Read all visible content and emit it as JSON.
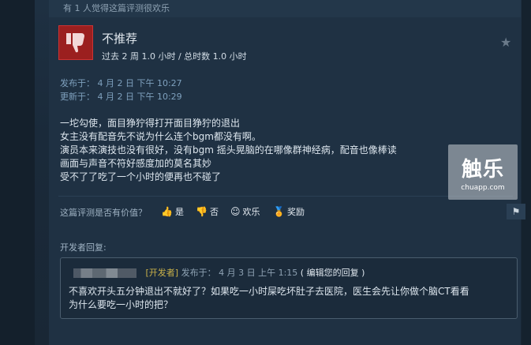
{
  "review": {
    "helpful_count_text": "有 1 人觉得这篇评测很欢乐",
    "verdict": "不推荐",
    "hours_text": "过去 2 周 1.0 小时 / 总时数 1.0 小时",
    "posted_line": "发布于：  4 月 2 日 下午 10:27",
    "updated_line": "更新于：  4 月 2 日 下午 10:29",
    "body_lines": [
      "一坨勾使，面目狰狞得打开面目狰狞的退出",
      "女主没有配音先不说为什么连个bgm都没有啊。",
      "演员本来演技也没有很好，没有bgm 摇头晃脑的在哪像群神经病，配音也像棒读",
      "画面与声音不符好感度加的莫名其妙",
      "受不了了吃了一个小时的便再也不碰了"
    ]
  },
  "vote": {
    "question": "这篇评测是否有价值？",
    "yes": "是",
    "no": "否",
    "funny": "欢乐",
    "award": "奖励"
  },
  "developer": {
    "section_label": "开发者回复:",
    "tag": "[开发者]",
    "posted": "发布于： 4 月 3 日 上午 1:15",
    "edit": "( 编辑您的回复 )",
    "reply_lines": [
      "不喜欢开头五分钟退出不就好了？如果吃一小时屎吃坏肚子去医院，医生会先让你做个脑CT看看",
      "为什么要吃一小时的把？"
    ]
  },
  "watermark": {
    "logo": "触乐",
    "url": "chuapp.com"
  },
  "colors": {
    "thumb_down_bg": "#9b1f1f",
    "dev_tag": "#c9b14a",
    "link_blue": "#7ea0bd"
  }
}
